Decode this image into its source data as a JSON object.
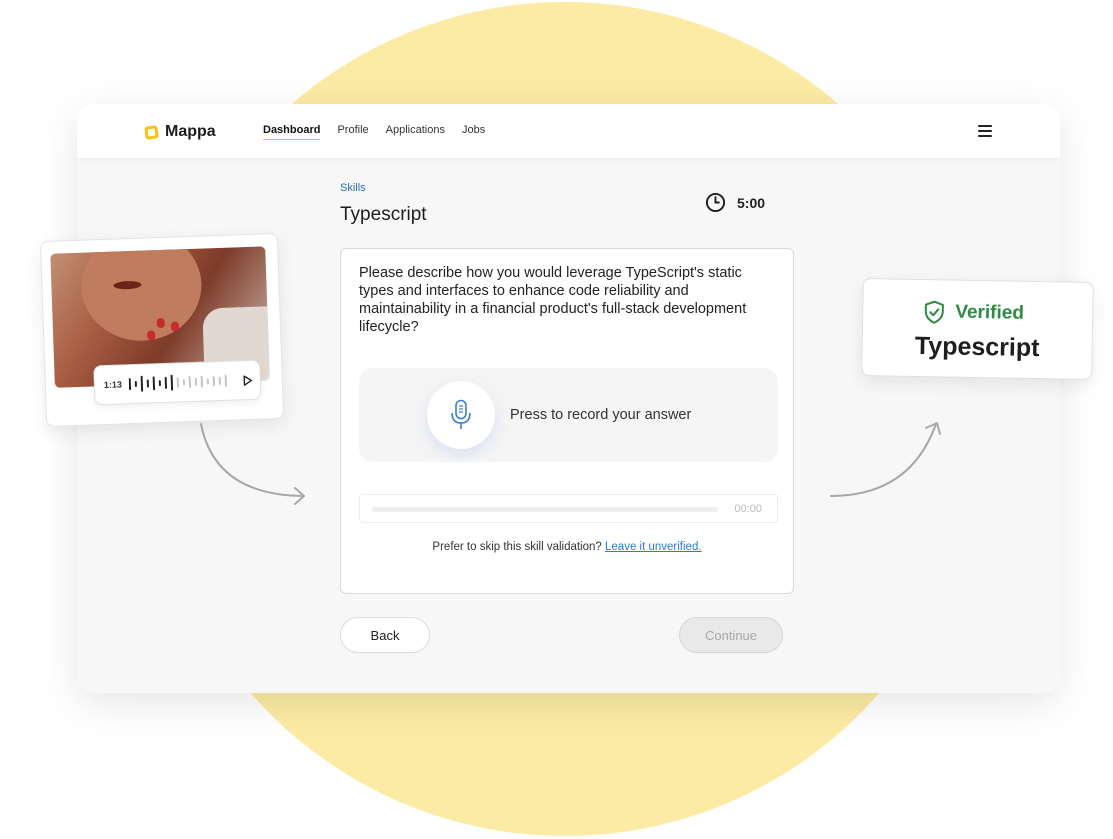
{
  "header": {
    "brand": "Mappa",
    "nav": [
      {
        "label": "Dashboard",
        "active": true
      },
      {
        "label": "Profile",
        "active": false
      },
      {
        "label": "Applications",
        "active": false
      },
      {
        "label": "Jobs",
        "active": false
      }
    ],
    "menu_icon": "hamburger-icon"
  },
  "main": {
    "breadcrumb": "Skills",
    "title": "Typescript",
    "timer": "5:00",
    "question": "Please describe how you would leverage TypeScript's static types and interfaces to enhance code reliability and maintainability in a financial product's full-stack development lifecycle?",
    "record_label": "Press to record your answer",
    "recording_time": "00:00",
    "recording_progress": 0,
    "skip_prefix": "Prefer to skip this skill validation?",
    "skip_link": "Leave it unverified."
  },
  "actions": {
    "back_label": "Back",
    "continue_label": "Continue",
    "continue_disabled": true
  },
  "video_card": {
    "audio_time": "1:13",
    "play_icon": "play-icon"
  },
  "verified_card": {
    "badge_label": "Verified",
    "skill": "Typescript",
    "badge_icon": "shield-check-icon"
  },
  "colors": {
    "accent_yellow": "#f2c40e",
    "background_circle": "#fbeba4",
    "verified_green": "#2e8b43",
    "link_blue": "#2e7bc4",
    "mic_blue": "#3b7fd0"
  }
}
